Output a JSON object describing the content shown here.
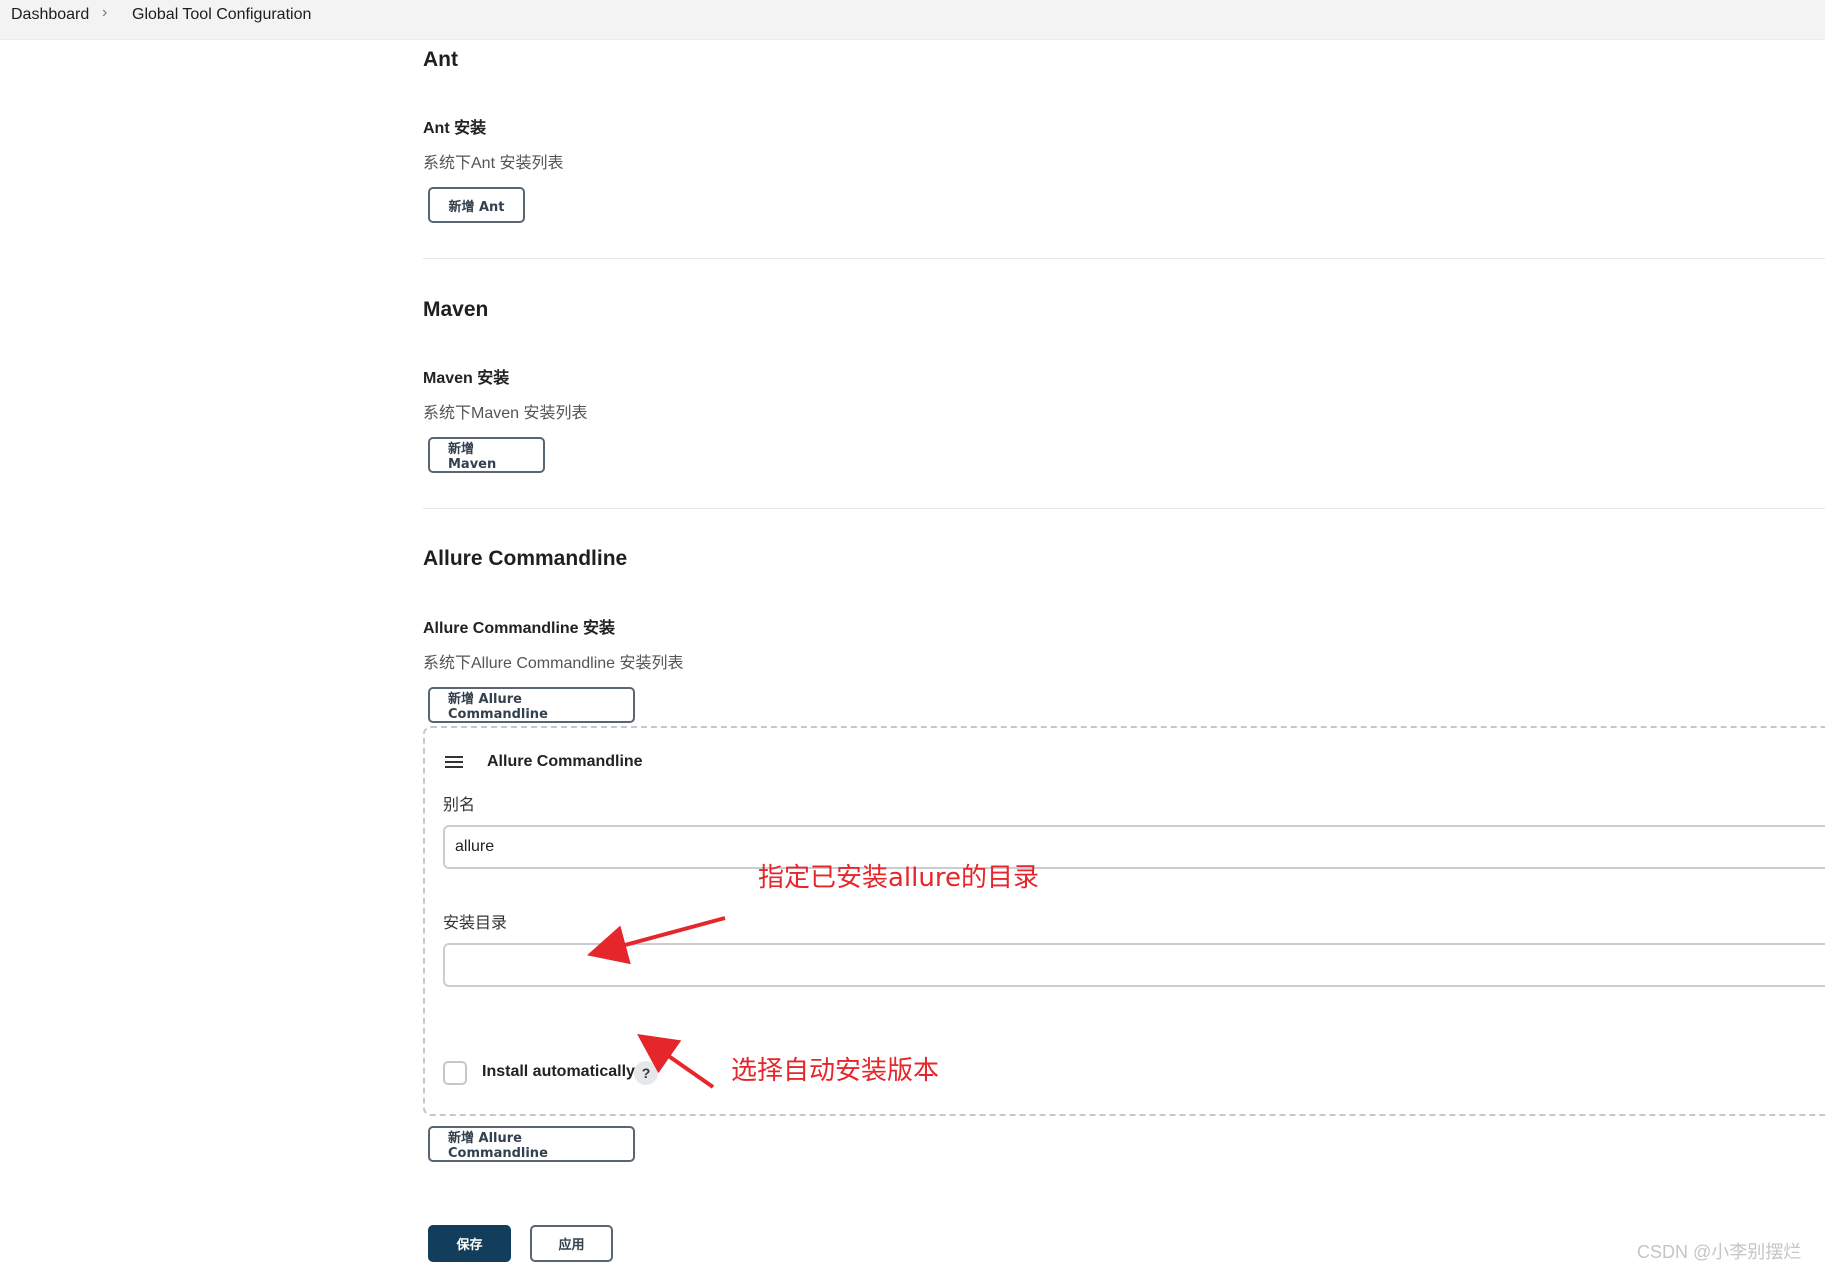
{
  "breadcrumb": {
    "items": [
      "Dashboard",
      "Global Tool Configuration"
    ],
    "separator": "›"
  },
  "sections": {
    "ant": {
      "title": "Ant",
      "install_label": "Ant 安装",
      "install_desc": "系统下Ant 安装列表",
      "add_button": "新增 Ant"
    },
    "maven": {
      "title": "Maven",
      "install_label": "Maven 安装",
      "install_desc": "系统下Maven 安装列表",
      "add_button": "新增 Maven"
    },
    "allure": {
      "title": "Allure Commandline",
      "install_label": "Allure Commandline 安装",
      "install_desc": "系统下Allure Commandline 安装列表",
      "add_button_top": "新增 Allure Commandline",
      "add_button_bottom": "新增 Allure Commandline",
      "installation": {
        "title": "Allure Commandline",
        "alias_label": "别名",
        "alias_value": "allure",
        "home_label": "安装目录",
        "home_value": "",
        "install_auto_label": "Install automatically",
        "help": "?"
      }
    }
  },
  "footer": {
    "save": "保存",
    "apply": "应用"
  },
  "annotations": {
    "home_note": "指定已安装allure的目录",
    "auto_note": "选择自动安装版本",
    "color": "#e5262a"
  },
  "watermark": "CSDN @小李别摆烂",
  "colors": {
    "primary": "#123e5c",
    "topbar": "#f3f3f3"
  }
}
